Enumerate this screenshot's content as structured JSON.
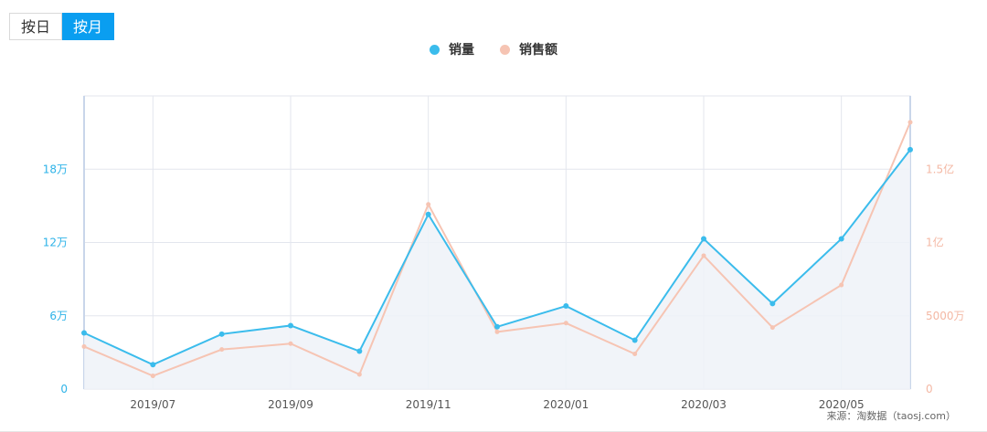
{
  "toggle": {
    "day_label": "按日",
    "month_label": "按月",
    "active": "month"
  },
  "source_note": "来源：淘数据（taosj.com）",
  "colors": {
    "sales": "#3bbcec",
    "revenue": "#f6c4b3",
    "area": "#eef2f8",
    "grid": "#e3e6ee"
  },
  "chart_data": {
    "type": "line",
    "x": [
      "2019/06",
      "2019/07",
      "2019/08",
      "2019/09",
      "2019/10",
      "2019/11",
      "2019/12",
      "2020/01",
      "2020/02",
      "2020/03",
      "2020/04",
      "2020/05",
      "2020/06"
    ],
    "x_tick_labels": [
      "2019/07",
      "2019/09",
      "2019/11",
      "2020/01",
      "2020/03",
      "2020/05"
    ],
    "series": [
      {
        "name": "销量",
        "axis": "left",
        "values": [
          46000,
          20000,
          45000,
          52000,
          31000,
          143000,
          51000,
          68000,
          40000,
          123000,
          70000,
          123000,
          196000
        ],
        "area": true
      },
      {
        "name": "销售额",
        "axis": "right",
        "values": [
          29000000,
          9000000,
          27000000,
          31000000,
          10000000,
          126000000,
          39000000,
          45000000,
          24000000,
          91000000,
          42000000,
          71000000,
          182000000
        ]
      }
    ],
    "y_left": {
      "ticks": [
        0,
        60000,
        120000,
        180000
      ],
      "tick_labels": [
        "0",
        "6万",
        "12万",
        "18万"
      ],
      "range": [
        0,
        240000
      ]
    },
    "y_right": {
      "ticks": [
        0,
        50000000,
        100000000,
        150000000
      ],
      "tick_labels": [
        "0",
        "5000万",
        "1亿",
        "1.5亿"
      ],
      "range": [
        0,
        200000000
      ]
    },
    "grid": true,
    "legend_position": "top-center"
  }
}
